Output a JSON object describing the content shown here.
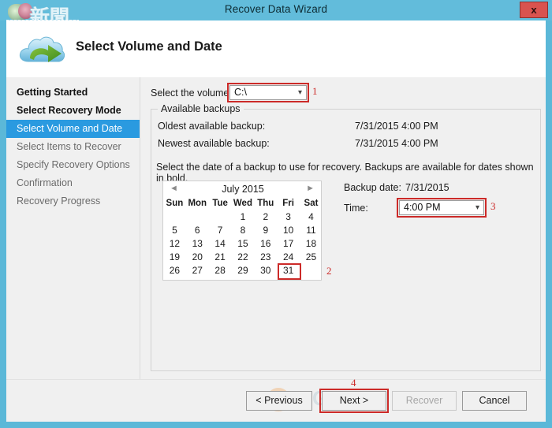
{
  "window": {
    "title": "Recover Data Wizard",
    "close_label": "x",
    "logo_text": "新聞",
    "accent_color": "#62bcdb",
    "highlight_color": "#2a9ae0",
    "annotation_color": "#cc2a28"
  },
  "header": {
    "title": "Select Volume and Date",
    "icon": "cloud-recovery-icon"
  },
  "sidebar": {
    "items": [
      {
        "label": "Getting Started",
        "state": "done"
      },
      {
        "label": "Select Recovery Mode",
        "state": "done"
      },
      {
        "label": "Select Volume and Date",
        "state": "current"
      },
      {
        "label": "Select Items to Recover",
        "state": "pending"
      },
      {
        "label": "Specify Recovery Options",
        "state": "pending"
      },
      {
        "label": "Confirmation",
        "state": "pending"
      },
      {
        "label": "Recovery Progress",
        "state": "pending"
      }
    ]
  },
  "content": {
    "volume_label": "Select the volume:",
    "volume_value": "C:\\",
    "volume_annotation": "1",
    "groupbox_legend": "Available backups",
    "oldest_label": "Oldest available backup:",
    "oldest_value": "7/31/2015 4:00 PM",
    "newest_label": "Newest available backup:",
    "newest_value": "7/31/2015 4:00 PM",
    "instruction": "Select the date of a backup to use for recovery. Backups are available for dates shown in bold.",
    "backup_date_label": "Backup date:",
    "backup_date_value": "7/31/2015",
    "time_label": "Time:",
    "time_value": "4:00 PM",
    "time_annotation": "3",
    "calendar_annotation": "2"
  },
  "calendar": {
    "title": "July 2015",
    "prev_icon": "◄",
    "next_icon": "►",
    "day_headers": [
      "Sun",
      "Mon",
      "Tue",
      "Wed",
      "Thu",
      "Fri",
      "Sat"
    ],
    "weeks": [
      [
        "",
        "",
        "",
        "1",
        "2",
        "3",
        "4"
      ],
      [
        "5",
        "6",
        "7",
        "8",
        "9",
        "10",
        "11"
      ],
      [
        "12",
        "13",
        "14",
        "15",
        "16",
        "17",
        "18"
      ],
      [
        "19",
        "20",
        "21",
        "22",
        "23",
        "24",
        "25"
      ],
      [
        "26",
        "27",
        "28",
        "29",
        "30",
        "31",
        ""
      ]
    ],
    "selected_day": "31"
  },
  "footer": {
    "previous_label": "< Previous",
    "next_label": "Next >",
    "recover_label": "Recover",
    "cancel_label": "Cancel",
    "next_annotation": "4",
    "recover_disabled": true
  },
  "watermark": {
    "letter": "G"
  }
}
